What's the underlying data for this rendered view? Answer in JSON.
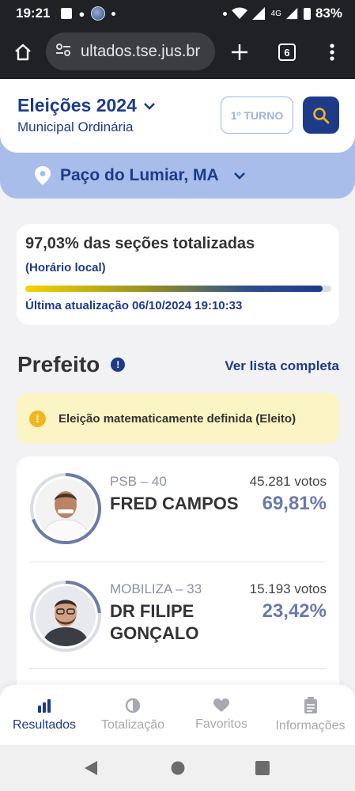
{
  "status_bar": {
    "time": "19:21",
    "network": "4G",
    "battery": "83%"
  },
  "browser": {
    "url": "ultados.tse.jus.br",
    "tab_count": "6"
  },
  "header": {
    "title": "Eleições 2024",
    "subtitle": "Municipal Ordinária",
    "turno_label": "1º TURNO"
  },
  "location": {
    "name": "Paço do Lumiar, MA"
  },
  "progress": {
    "sections_text": "97,03% das seções totalizadas",
    "local_time_note": "(Horário local)",
    "percent": 97.03,
    "last_update": "Última atualização 06/10/2024 19:10:33"
  },
  "section": {
    "title": "Prefeito",
    "see_all": "Ver lista completa"
  },
  "notice": {
    "text": "Eleição matematicamente definida (Eleito)"
  },
  "candidates": [
    {
      "party": "PSB – 40",
      "name": "FRED CAMPOS",
      "votes": "45.281 votos",
      "percent": "69,81%",
      "share": 0.6981
    },
    {
      "party": "MOBILIZA – 33",
      "name_line1": "DR FILIPE",
      "name_line2": "GONÇALO",
      "votes": "15.193 votos",
      "percent": "23,42%",
      "share": 0.2342
    }
  ],
  "bottom_nav": [
    {
      "label": "Resultados",
      "icon": "bar-chart-icon",
      "active": true
    },
    {
      "label": "Totalização",
      "icon": "pie-chart-icon",
      "active": false
    },
    {
      "label": "Favoritos",
      "icon": "heart-icon",
      "active": false
    },
    {
      "label": "Informações",
      "icon": "clipboard-icon",
      "active": false
    }
  ],
  "colors": {
    "primary": "#1e3b8a",
    "band": "#a8bde9",
    "notice": "#fbf4c4",
    "warning": "#f2b51d"
  }
}
